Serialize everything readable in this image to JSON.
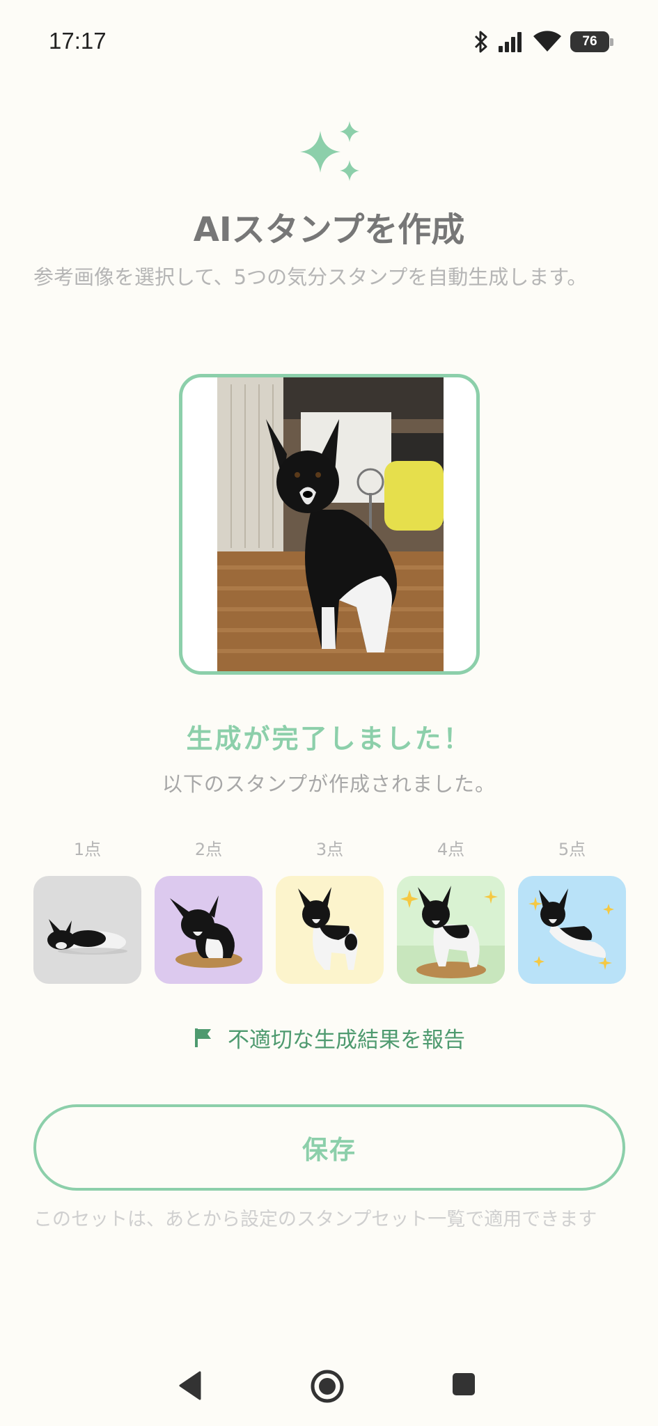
{
  "status_bar": {
    "time": "17:17",
    "battery": "76",
    "icons": [
      "bluetooth-icon",
      "signal-icon",
      "wifi-icon",
      "battery-icon"
    ]
  },
  "header": {
    "icon": "sparkle-icon",
    "title": "AIスタンプを作成",
    "subtitle": "参考画像を選択して、5つの気分スタンプを自動生成します。"
  },
  "reference_image": {
    "description_icon": "reference-photo"
  },
  "result": {
    "title": "生成が完了しました！",
    "subtitle": "以下のスタンプが作成されました。"
  },
  "stamps": [
    {
      "label": "1点",
      "bg": "#dcdcdc"
    },
    {
      "label": "2点",
      "bg": "#dcc9ee"
    },
    {
      "label": "3点",
      "bg": "#fcf4cc"
    },
    {
      "label": "4点",
      "bg": "#d9f2d2"
    },
    {
      "label": "5点",
      "bg": "#b9e2f8"
    }
  ],
  "report": {
    "icon": "flag-icon",
    "label": "不適切な生成結果を報告"
  },
  "save_button": {
    "label": "保存"
  },
  "note": "このセットは、あとから設定のスタンプセット一覧で適用できます",
  "colors": {
    "accent": "#8ccfaa",
    "accent_dark": "#4e9a6f",
    "background": "#fdfcf7",
    "muted_text": "#b5b5b5"
  },
  "nav_bar": {
    "icons": [
      "back-icon",
      "home-icon",
      "recents-icon"
    ]
  }
}
